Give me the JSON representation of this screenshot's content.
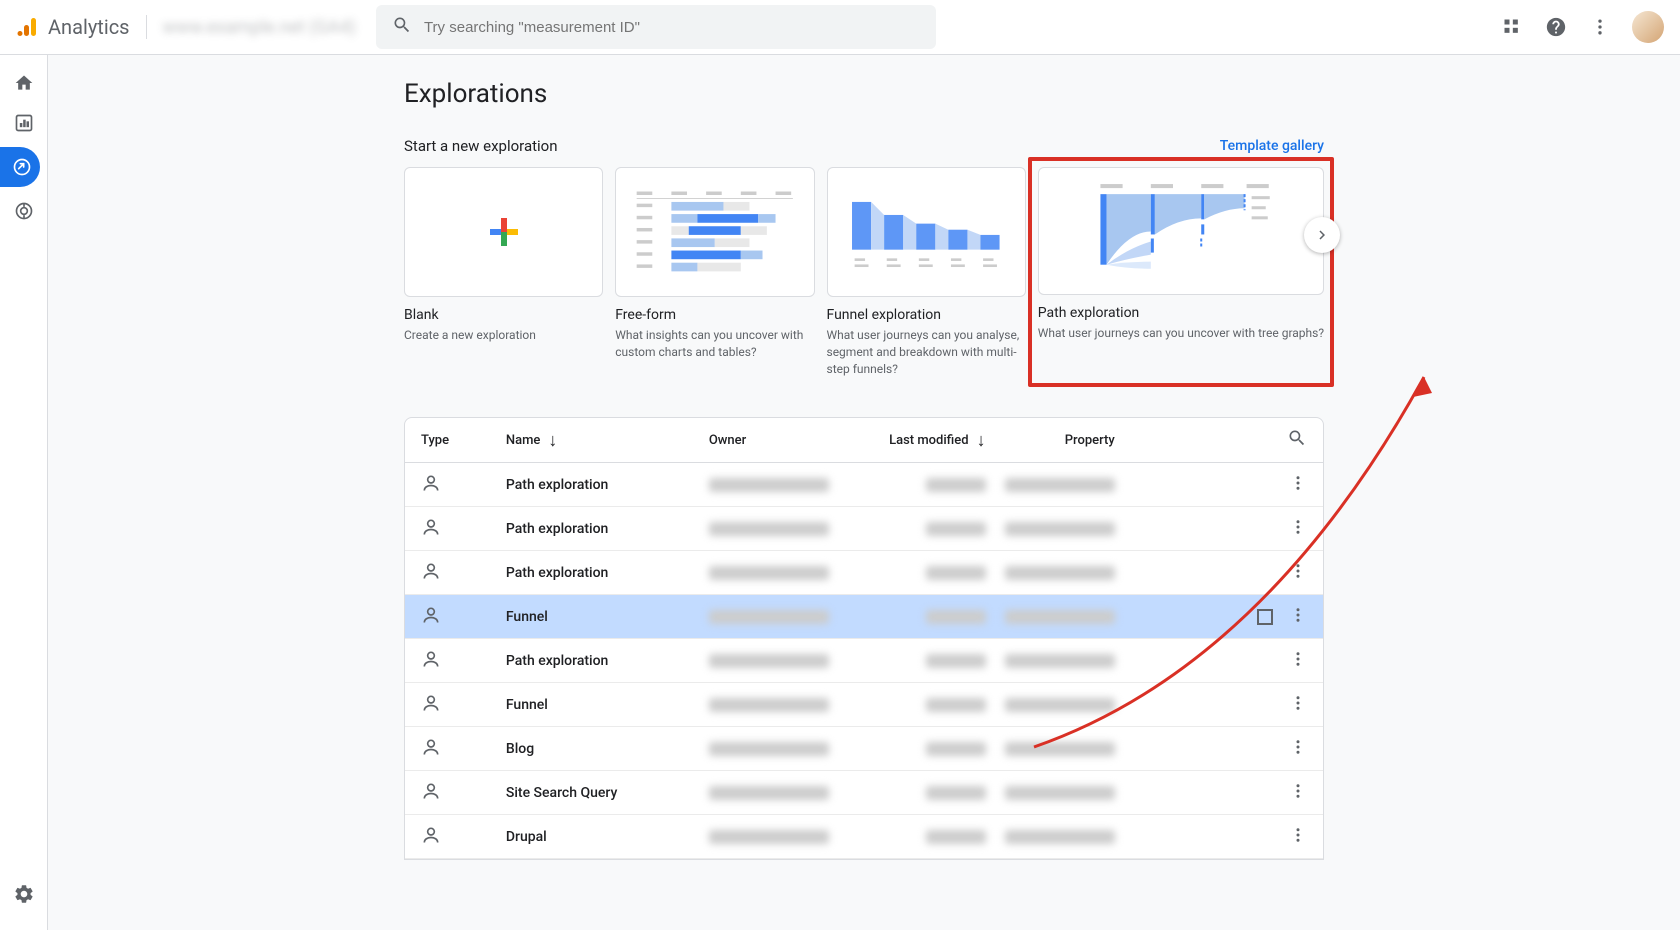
{
  "header": {
    "logo_text": "Analytics",
    "property_text": "www.example.net (GA4)",
    "search_placeholder": "Try searching \"measurement ID\""
  },
  "page": {
    "title": "Explorations",
    "start_label": "Start a new exploration",
    "gallery_link": "Template gallery"
  },
  "cards": {
    "blank": {
      "title": "Blank",
      "desc": "Create a new exploration"
    },
    "freeform": {
      "title": "Free-form",
      "desc": "What insights can you uncover with custom charts and tables?"
    },
    "funnel": {
      "title": "Funnel exploration",
      "desc": "What user journeys can you analyse, segment and breakdown with multi-step funnels?"
    },
    "path": {
      "title": "Path exploration",
      "desc": "What user journeys can you uncover with tree graphs?"
    }
  },
  "table": {
    "headers": {
      "type": "Type",
      "name": "Name",
      "owner": "Owner",
      "modified": "Last modified",
      "property": "Property"
    },
    "rows": [
      {
        "name": "Path exploration",
        "selected": false
      },
      {
        "name": "Path exploration",
        "selected": false
      },
      {
        "name": "Path exploration",
        "selected": false
      },
      {
        "name": "Funnel",
        "selected": true
      },
      {
        "name": "Path exploration",
        "selected": false
      },
      {
        "name": "Funnel",
        "selected": false
      },
      {
        "name": "Blog",
        "selected": false
      },
      {
        "name": "Site Search Query",
        "selected": false
      },
      {
        "name": "Drupal",
        "selected": false
      }
    ]
  }
}
